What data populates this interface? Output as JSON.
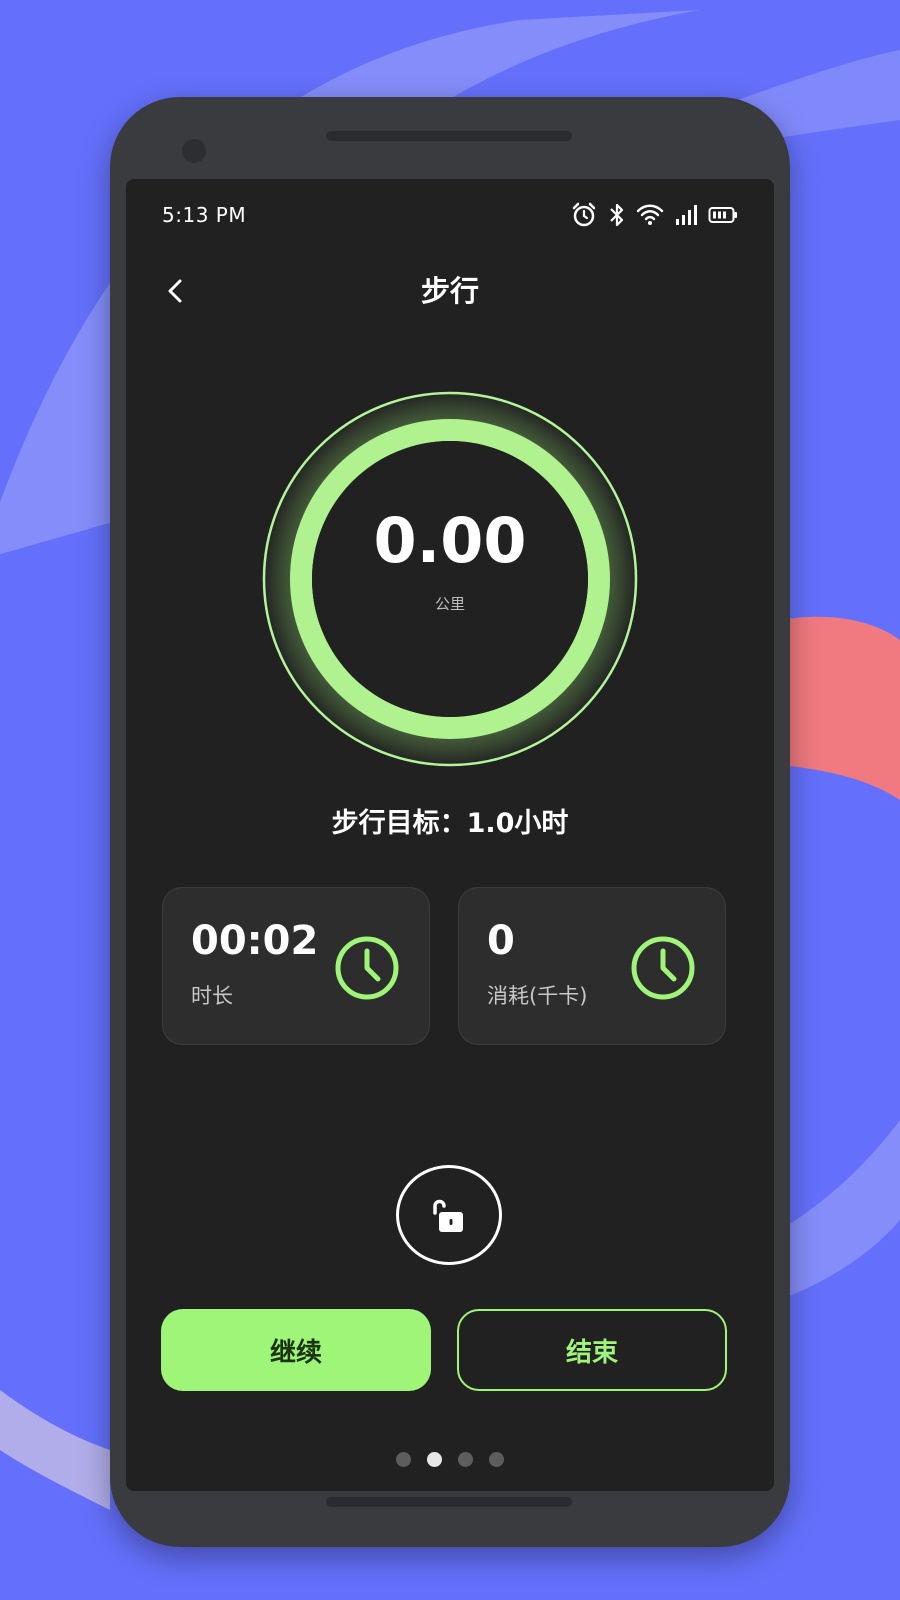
{
  "status_bar": {
    "time": "5:13 PM",
    "icons": [
      "alarm-icon",
      "bluetooth-icon",
      "wifi-icon",
      "signal-icon",
      "battery-icon"
    ]
  },
  "header": {
    "title": "步行",
    "back_icon": "chevron-left-icon"
  },
  "distance": {
    "value": "0.00",
    "unit": "公里"
  },
  "goal": {
    "text": "步行目标：1.0小时"
  },
  "stats": [
    {
      "value": "00:02",
      "label": "时长",
      "icon": "clock-icon"
    },
    {
      "value": "0",
      "label": "消耗(千卡)",
      "icon": "clock-icon"
    }
  ],
  "lock": {
    "icon": "unlock-icon"
  },
  "buttons": {
    "continue_label": "继续",
    "end_label": "结束"
  },
  "pager": {
    "count": 4,
    "active_index": 1
  },
  "colors": {
    "background": "#6470fb",
    "screen": "#212121",
    "accent_green": "#9ef578",
    "card": "#2d2d2d"
  }
}
